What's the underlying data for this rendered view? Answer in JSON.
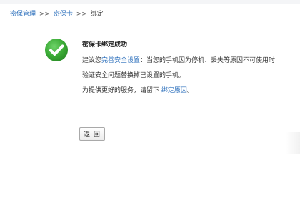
{
  "breadcrumb": {
    "item1": "密保管理",
    "sep1": ">>",
    "item2": "密保卡",
    "sep2": ">>",
    "current": "绑定"
  },
  "icon": {
    "name": "success-check-icon",
    "color": "#3aaa35"
  },
  "message": {
    "title": "密保卡绑定成功",
    "line1_prefix": "建议您",
    "line1_link": "完善安全设置",
    "line1_suffix": "：当您的手机因为停机、丢失等原因不可使用时",
    "line2": "验证安全问题替换掉已设置的手机。",
    "line3_prefix": "为提供更好的服务，请留下 ",
    "line3_link": "绑定原因",
    "line3_suffix": "。"
  },
  "actions": {
    "back_label": "返 回"
  },
  "colors": {
    "link": "#2a6ebb",
    "text": "#333333"
  }
}
